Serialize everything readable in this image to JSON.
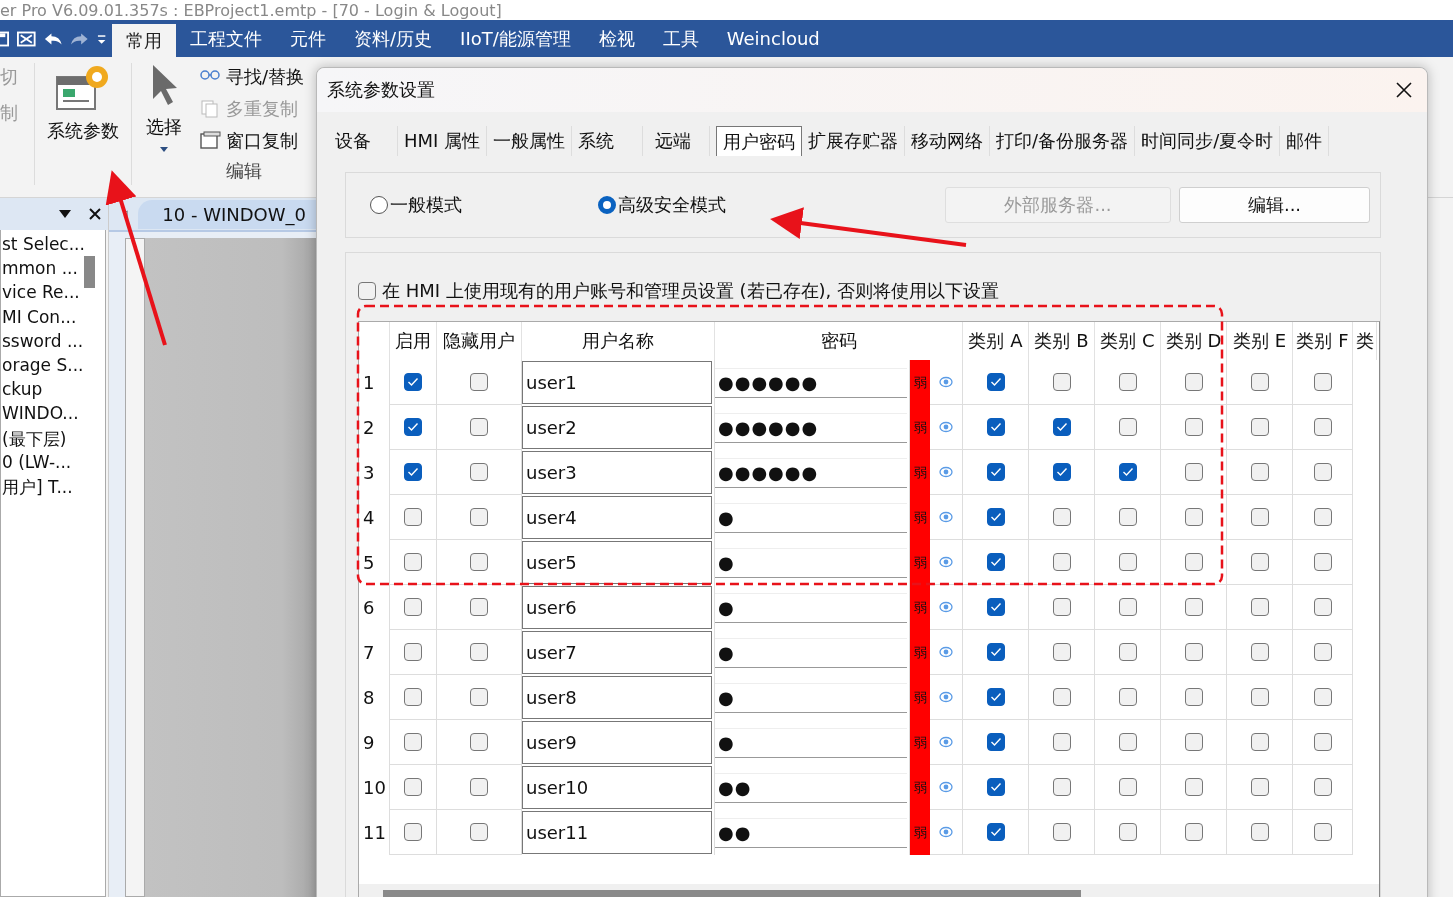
{
  "app": {
    "title": "er Pro V6.09.01.357s : EBProject1.emtp - [70 - Login & Logout]"
  },
  "ribbon": {
    "tabs": [
      {
        "label": "常用",
        "selected": true
      },
      {
        "label": "工程文件",
        "selected": false
      },
      {
        "label": "元件",
        "selected": false
      },
      {
        "label": "资料/历史",
        "selected": false
      },
      {
        "label": "IIoT/能源管理",
        "selected": false
      },
      {
        "label": "检视",
        "selected": false
      },
      {
        "label": "工具",
        "selected": false
      },
      {
        "label": "Weincloud",
        "selected": false
      }
    ],
    "clipboard": [
      {
        "label": "切",
        "disabled": true
      },
      {
        "label": "制",
        "disabled": true
      }
    ],
    "system_button": "系统参数",
    "select_button": "选择",
    "edit_items": [
      {
        "kind": "find",
        "label": "寻找/替换",
        "disabled": false
      },
      {
        "kind": "multi",
        "label": "多重复制",
        "disabled": true
      },
      {
        "kind": "window",
        "label": "窗口复制",
        "disabled": false
      }
    ],
    "group_label": "编辑"
  },
  "project_panel": {
    "items": [
      "st Selec...",
      "mmon ...",
      "vice Re...",
      "MI Con...",
      "ssword ...",
      "orage S...",
      "ckup",
      "WINDO...",
      "(最下层)",
      "0 (LW-...",
      "用户] T..."
    ]
  },
  "editor": {
    "tab": "10 - WINDOW_0"
  },
  "dialog": {
    "title": "系统参数设置",
    "tabs": [
      {
        "label": "设备",
        "selected": false
      },
      {
        "label": "HMI 属性",
        "selected": false
      },
      {
        "label": "一般属性",
        "selected": false
      },
      {
        "label": "系统",
        "selected": false
      },
      {
        "label": "远端",
        "selected": false
      },
      {
        "label": "用户密码",
        "selected": true
      },
      {
        "label": "扩展存贮器",
        "selected": false
      },
      {
        "label": "移动网络",
        "selected": false
      },
      {
        "label": "打印/备份服务器",
        "selected": false
      },
      {
        "label": "时间同步/夏令时",
        "selected": false
      },
      {
        "label": "邮件",
        "selected": false
      }
    ],
    "modes": [
      {
        "label": "一般模式",
        "selected": false
      },
      {
        "label": "高级安全模式",
        "selected": true
      }
    ],
    "buttons": [
      {
        "label": "外部服务器...",
        "disabled": true
      },
      {
        "label": "编辑...",
        "disabled": false
      }
    ],
    "use_existing": {
      "label": "在 HMI 上使用现有的用户账号和管理员设置 (若已存在), 否则将使用以下设置",
      "checked": false
    },
    "table": {
      "columns": [
        "启用",
        "隐藏用户",
        "用户名称",
        "密码"
      ],
      "categories": [
        "类别 A",
        "类别 B",
        "类别 C",
        "类别 D",
        "类别 E",
        "类别 F",
        "类"
      ],
      "rows": [
        {
          "number": "1",
          "enabled": true,
          "hidden": false,
          "username": "user1",
          "password": "●●●●●●",
          "strength": "弱",
          "categories": [
            true,
            false,
            false,
            false,
            false,
            false
          ]
        },
        {
          "number": "2",
          "enabled": true,
          "hidden": false,
          "username": "user2",
          "password": "●●●●●●",
          "strength": "弱",
          "categories": [
            true,
            true,
            false,
            false,
            false,
            false
          ]
        },
        {
          "number": "3",
          "enabled": true,
          "hidden": false,
          "username": "user3",
          "password": "●●●●●●",
          "strength": "弱",
          "categories": [
            true,
            true,
            true,
            false,
            false,
            false
          ]
        },
        {
          "number": "4",
          "enabled": false,
          "hidden": false,
          "username": "user4",
          "password": "●",
          "strength": "弱",
          "categories": [
            true,
            false,
            false,
            false,
            false,
            false
          ]
        },
        {
          "number": "5",
          "enabled": false,
          "hidden": false,
          "username": "user5",
          "password": "●",
          "strength": "弱",
          "categories": [
            true,
            false,
            false,
            false,
            false,
            false
          ]
        },
        {
          "number": "6",
          "enabled": false,
          "hidden": false,
          "username": "user6",
          "password": "●",
          "strength": "弱",
          "categories": [
            true,
            false,
            false,
            false,
            false,
            false
          ]
        },
        {
          "number": "7",
          "enabled": false,
          "hidden": false,
          "username": "user7",
          "password": "●",
          "strength": "弱",
          "categories": [
            true,
            false,
            false,
            false,
            false,
            false
          ]
        },
        {
          "number": "8",
          "enabled": false,
          "hidden": false,
          "username": "user8",
          "password": "●",
          "strength": "弱",
          "categories": [
            true,
            false,
            false,
            false,
            false,
            false
          ]
        },
        {
          "number": "9",
          "enabled": false,
          "hidden": false,
          "username": "user9",
          "password": "●",
          "strength": "弱",
          "categories": [
            true,
            false,
            false,
            false,
            false,
            false
          ]
        },
        {
          "number": "10",
          "enabled": false,
          "hidden": false,
          "username": "user10",
          "password": "●●",
          "strength": "弱",
          "categories": [
            true,
            false,
            false,
            false,
            false,
            false
          ]
        },
        {
          "number": "11",
          "enabled": false,
          "hidden": false,
          "username": "user11",
          "password": "●●",
          "strength": "弱",
          "categories": [
            true,
            false,
            false,
            false,
            false,
            false
          ]
        }
      ]
    }
  }
}
